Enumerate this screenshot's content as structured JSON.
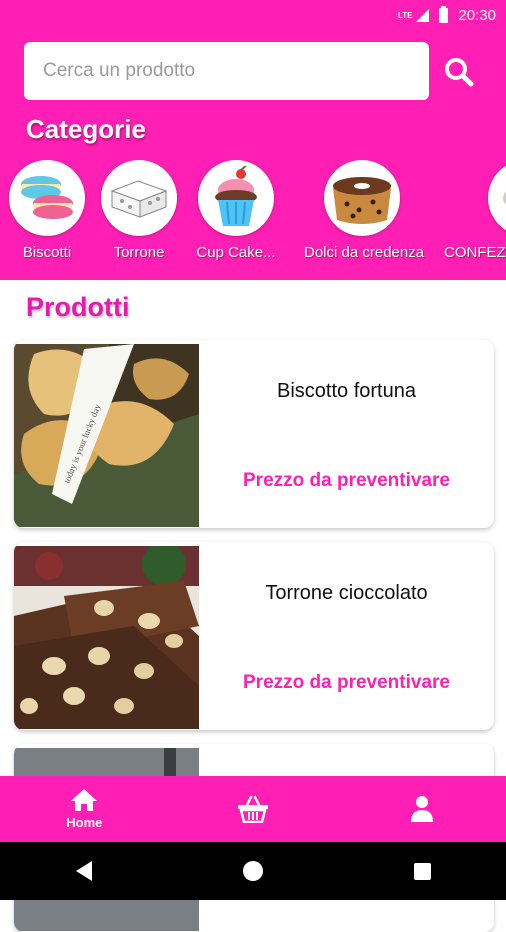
{
  "status_bar": {
    "network": "LTE",
    "time": "20:30"
  },
  "search": {
    "placeholder": "Cerca un prodotto",
    "value": ""
  },
  "categories_title": "Categorie",
  "categories": [
    {
      "label": "Biscotti",
      "icon": "macaron-icon"
    },
    {
      "label": "Torrone",
      "icon": "nougat-icon"
    },
    {
      "label": "Cup Cake...",
      "icon": "cupcake-icon"
    },
    {
      "label": "Dolci da credenza",
      "icon": "bundt-cake-icon"
    },
    {
      "label": "CONFEZ",
      "icon": "gift-box-icon"
    }
  ],
  "products_title": "Prodotti",
  "products": [
    {
      "name": "Biscotto fortuna",
      "price": "Prezzo da preventivare",
      "image": "fortune-cookie-image",
      "note_text": "today is your lucky day"
    },
    {
      "name": "Torrone cioccolato",
      "price": "Prezzo da preventivare",
      "image": "chocolate-nougat-image"
    }
  ],
  "bottom_nav": [
    {
      "label": "Home",
      "icon": "home-icon"
    },
    {
      "label": "",
      "icon": "basket-icon"
    },
    {
      "label": "",
      "icon": "user-icon"
    }
  ],
  "colors": {
    "accent": "#ff1fb4",
    "section_title": "#e819ad",
    "price": "#ff1fb4"
  }
}
